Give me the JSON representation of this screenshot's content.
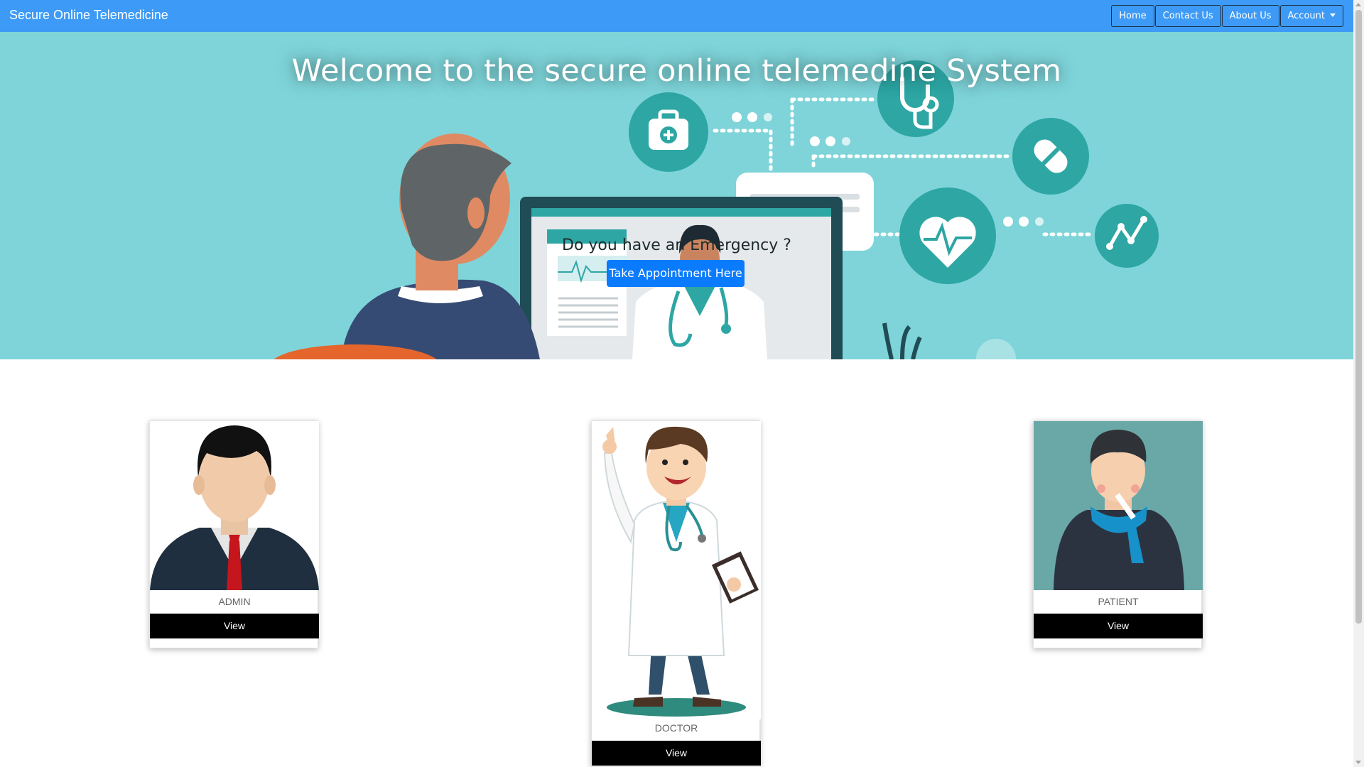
{
  "navbar": {
    "brand": "Secure Online Telemedicine",
    "links": [
      "Home",
      "Contact Us",
      "About Us",
      "Account"
    ],
    "color": "#3d9bf7"
  },
  "hero": {
    "title": "Welcome to the secure online telemedine System",
    "emergency_text": "Do you have an Emergency ?",
    "appointment_button": "Take Appointment Here",
    "background": "#7ed4d9",
    "icons": [
      "first-aid-kit-icon",
      "stethoscope-icon",
      "pill-icon",
      "heart-pulse-icon",
      "chart-line-icon"
    ]
  },
  "cards": [
    {
      "label": "ADMIN",
      "button": "View"
    },
    {
      "label": "DOCTOR",
      "button": "View"
    },
    {
      "label": "PATIENT",
      "button": "View"
    }
  ]
}
